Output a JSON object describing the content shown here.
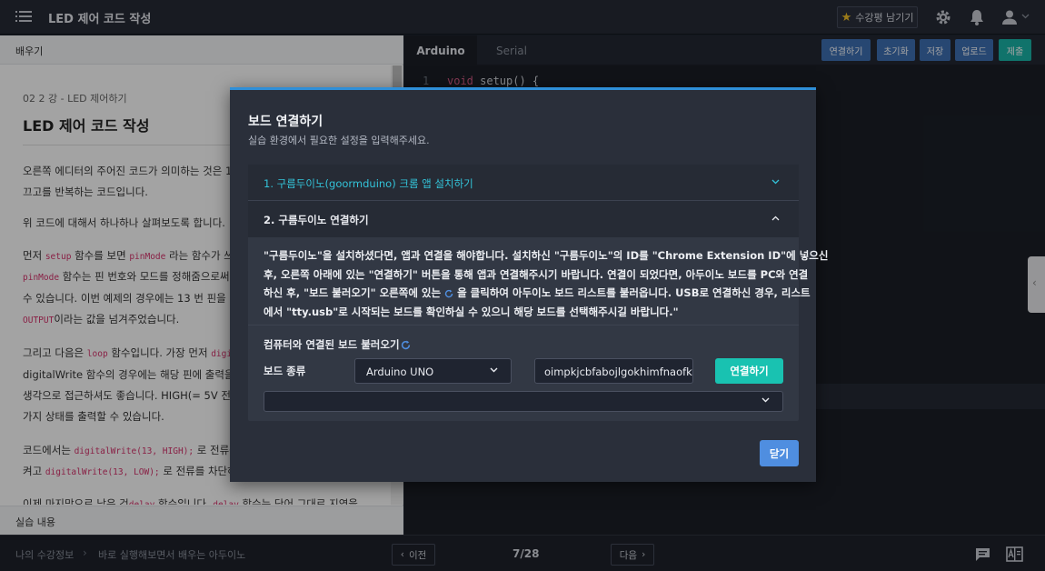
{
  "header": {
    "app_title": "LED 제어 코드 작성",
    "review_label": "수강평 남기기"
  },
  "lesson": {
    "panel_title": "배우기",
    "breadcrumb": "02 2 강 - LED 제어하기",
    "title": "LED 제어 코드 작성",
    "footer_label": "실습 내용",
    "paragraphs": [
      {
        "t1": "오른쪽 에디터의 주어진 코드가 의미하는 것은 1"
      },
      {
        "t1": "끄고를 반복하는 코드입니다."
      },
      {
        "t1": "위 코드에 대해서 하나하나 살펴보도록 합니다."
      },
      {
        "t1": "먼저 ",
        "c1": "setup",
        "t2": " 함수를 보면 ",
        "c2": "pinMode",
        "t3": " 라는 함수가 쓰"
      },
      {
        "c1": "pinMode",
        "t2": " 함수는 핀 번호와 모드를 정해줌으로써,"
      },
      {
        "t1": "수 있습니다. 이번 예제의 경우에는 13 번 핀을 이"
      },
      {
        "c1": "OUTPUT",
        "t2": "이라는 값을 넘겨주었습니다."
      },
      {
        "t1": "그리고 다음은 ",
        "c1": "loop",
        "t2": " 함수입니다. 가장 먼저 ",
        "c2": "digit"
      },
      {
        "t1": "digitalWrite 함수의 경우에는 해당 핀에 출력을"
      },
      {
        "t1": "생각으로 접근하셔도 좋습니다. HIGH(= 5V 전류"
      },
      {
        "t1": "가지 상태를 출력할 수 있습니다."
      },
      {
        "t1": "코드에서는 ",
        "c1": "digitalWrite(13, HIGH);",
        "t2": " 로 전류를"
      },
      {
        "t1": "켜고 ",
        "c1": "digitalWrite(13, LOW);",
        "t2": " 로 전류를 차단하"
      },
      {
        "t1": "이제 마지막으로 남은 것",
        "c1": "delay",
        "t2": " 함수입니다. ",
        "c2": "delay",
        "t3": " 함수는 단어 그대로 지연을"
      }
    ]
  },
  "editor": {
    "tabs": [
      "Arduino",
      "Serial"
    ],
    "buttons": [
      "연결하기",
      "초기화",
      "저장",
      "업로드",
      "제출"
    ],
    "line_number": "1",
    "code_keyword": "void",
    "code_rest": " setup() {"
  },
  "modal": {
    "title": "보드 연결하기",
    "subtitle": "실습 환경에서 필요한 설정을 입력해주세요.",
    "section1": "1. 구름두이노(goormduino) 크롬 앱 설치하기",
    "section2": "2. 구름두이노 연결하기",
    "body_lines": [
      "\"구름두이노\"을 설치하셨다면, 앱과 연결을 해야합니다. 설치하신 \"구름두이노\"의 ID를 \"Chrome Extension ID\"에 넣으신",
      "후, 오른쪽 아래에 있는 \"연결하기\" 버튼을 통해 앱과 연결해주시기 바랍니다. 연결이 되었다면, 아두이노 보드를 PC와 연결",
      "하신 후, \"보드 불러오기\" 오른쪽에 있는 ",
      " 을 클릭하여 아두이노 보드 리스트를 불러옵니다. USB로 연결하신 경우, 리스트",
      "에서 \"tty.usb\"로 시작되는 보드를 확인하실 수 있으니 해당 보드를 선택해주시길 바랍니다.\""
    ],
    "load_label": "컴퓨터와 연결된 보드 불러오기",
    "board_type_label": "보드 종류",
    "board_type_value": "Arduino UNO",
    "extension_id": "oimpkjcbfabojlgokhimfnaofk",
    "connect_label": "연결하기",
    "close_label": "닫기"
  },
  "footer": {
    "crumb1": "나의 수강정보",
    "crumb_sep": "›",
    "crumb2": "바로 실행해보면서 배우는 아두이노",
    "prev_label": "이전",
    "next_label": "다음",
    "page": "7/28"
  },
  "colors": {
    "accent_blue": "#2f8fd8",
    "teal": "#19c2b1",
    "close_blue": "#4f8ee0",
    "star": "#f2c028"
  },
  "icons": [
    "menu-icon",
    "star-icon",
    "gear-icon",
    "bell-icon",
    "user-icon",
    "chevron-down-icon",
    "refresh-icon",
    "chat-icon",
    "dictionary-icon"
  ]
}
